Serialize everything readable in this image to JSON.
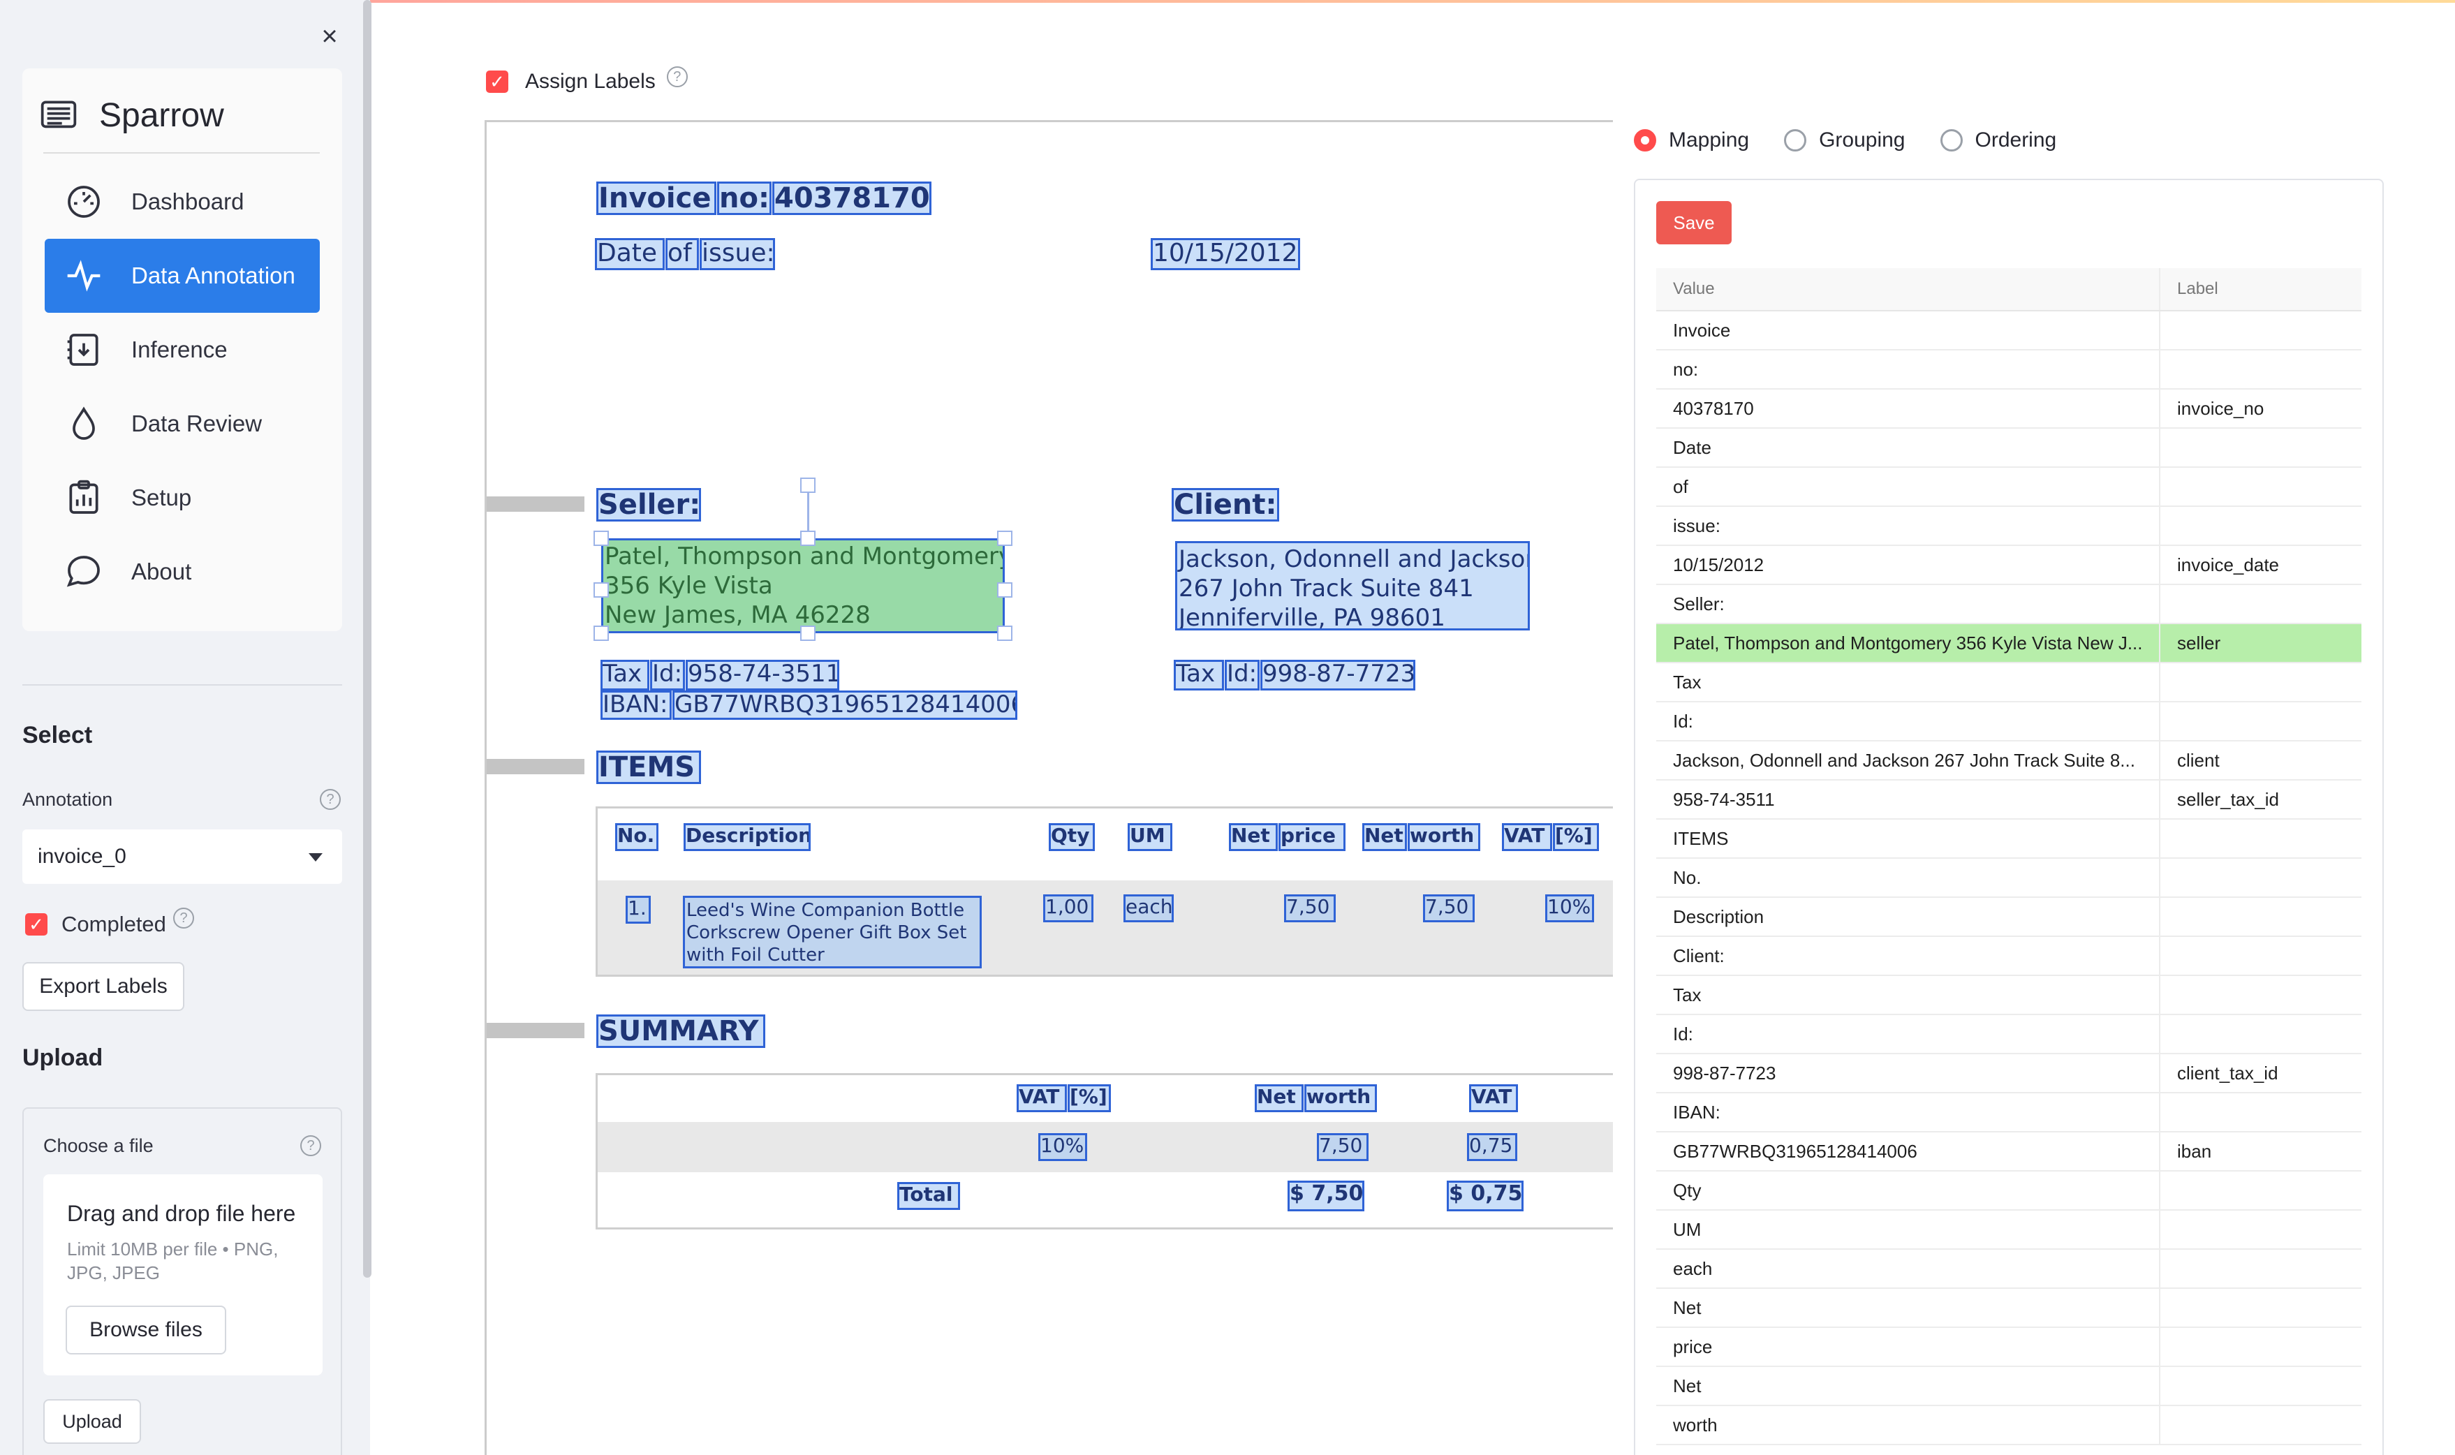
{
  "app": {
    "close_symbol": "×"
  },
  "sidebar": {
    "brand": "Sparrow",
    "nav": [
      {
        "label": "Dashboard",
        "icon": "dashboard-icon"
      },
      {
        "label": "Data Annotation",
        "icon": "activity-icon",
        "active": true
      },
      {
        "label": "Inference",
        "icon": "inference-icon"
      },
      {
        "label": "Data Review",
        "icon": "droplet-icon"
      },
      {
        "label": "Setup",
        "icon": "clipboard-chart-icon"
      },
      {
        "label": "About",
        "icon": "chat-bubble-icon"
      }
    ],
    "select_heading": "Select",
    "annotation_label": "Annotation",
    "annotation_value": "invoice_0",
    "completed_label": "Completed",
    "export_button": "Export Labels",
    "upload_heading": "Upload",
    "choose_file_label": "Choose a file",
    "drop_title": "Drag and drop file here",
    "drop_hint": "Limit 10MB per file • PNG, JPG, JPEG",
    "browse_button": "Browse files",
    "upload_button": "Upload"
  },
  "main": {
    "assign_labels": "Assign Labels",
    "check_mark": "✓",
    "help_mark": "?"
  },
  "invoice": {
    "invoice": "Invoice",
    "no": "no:",
    "number": "40378170",
    "date": "Date",
    "of": "of",
    "issue": "issue:",
    "date_value": "10/15/2012",
    "seller_heading": "Seller:",
    "client_heading": "Client:",
    "seller_lines": [
      "Patel, Thompson and Montgomery",
      "356 Kyle Vista",
      "New James, MA 46228"
    ],
    "client_lines": [
      "Jackson, Odonnell and Jackson",
      "267 John Track Suite 841",
      "Jenniferville, PA 98601"
    ],
    "tax": "Tax",
    "id": "Id:",
    "seller_tax_id": "958-74-3511",
    "client_tax_id": "998-87-7723",
    "iban": "IBAN:",
    "iban_value": "GB77WRBQ31965128414006",
    "items_heading": "ITEMS",
    "col_no": "No.",
    "col_desc": "Description",
    "col_qty": "Qty",
    "col_um": "UM",
    "col_net": "Net",
    "col_price": "price",
    "col_worth": "worth",
    "col_vat": "VAT",
    "col_pct": "[%]",
    "item_no": "1.",
    "item_desc": [
      "Leed's Wine Companion Bottle",
      "Corkscrew Opener Gift Box Set",
      "with Foil Cutter"
    ],
    "item_qty": "1,00",
    "item_um": "each",
    "item_price": "7,50",
    "item_worth": "7,50",
    "item_vat": "10%",
    "summary_heading": "SUMMARY",
    "sum_vat_pct": "10%",
    "sum_net": "7,50",
    "sum_vat": "0,75",
    "total_label": "Total",
    "total_net": "$ 7,50",
    "total_vat": "$ 0,75"
  },
  "panel": {
    "modes": [
      "Mapping",
      "Grouping",
      "Ordering"
    ],
    "selected_mode": "Mapping",
    "save_button": "Save",
    "columns": [
      "Value",
      "Label"
    ],
    "rows": [
      {
        "value": "Invoice",
        "label": ""
      },
      {
        "value": "no:",
        "label": ""
      },
      {
        "value": "40378170",
        "label": "invoice_no"
      },
      {
        "value": "Date",
        "label": ""
      },
      {
        "value": "of",
        "label": ""
      },
      {
        "value": "issue:",
        "label": ""
      },
      {
        "value": "10/15/2012",
        "label": "invoice_date"
      },
      {
        "value": "Seller:",
        "label": ""
      },
      {
        "value": "Patel, Thompson and Montgomery 356 Kyle Vista New J...",
        "label": "seller",
        "highlight": true
      },
      {
        "value": "Tax",
        "label": ""
      },
      {
        "value": "Id:",
        "label": ""
      },
      {
        "value": "Jackson, Odonnell and Jackson 267 John Track Suite 8...",
        "label": "client"
      },
      {
        "value": "958-74-3511",
        "label": "seller_tax_id"
      },
      {
        "value": "ITEMS",
        "label": ""
      },
      {
        "value": "No.",
        "label": ""
      },
      {
        "value": "Description",
        "label": ""
      },
      {
        "value": "Client:",
        "label": ""
      },
      {
        "value": "Tax",
        "label": ""
      },
      {
        "value": "Id:",
        "label": ""
      },
      {
        "value": "998-87-7723",
        "label": "client_tax_id"
      },
      {
        "value": "IBAN:",
        "label": ""
      },
      {
        "value": "GB77WRBQ31965128414006",
        "label": "iban"
      },
      {
        "value": "Qty",
        "label": ""
      },
      {
        "value": "UM",
        "label": ""
      },
      {
        "value": "each",
        "label": ""
      },
      {
        "value": "Net",
        "label": ""
      },
      {
        "value": "price",
        "label": ""
      },
      {
        "value": "Net",
        "label": ""
      },
      {
        "value": "worth",
        "label": ""
      }
    ]
  }
}
